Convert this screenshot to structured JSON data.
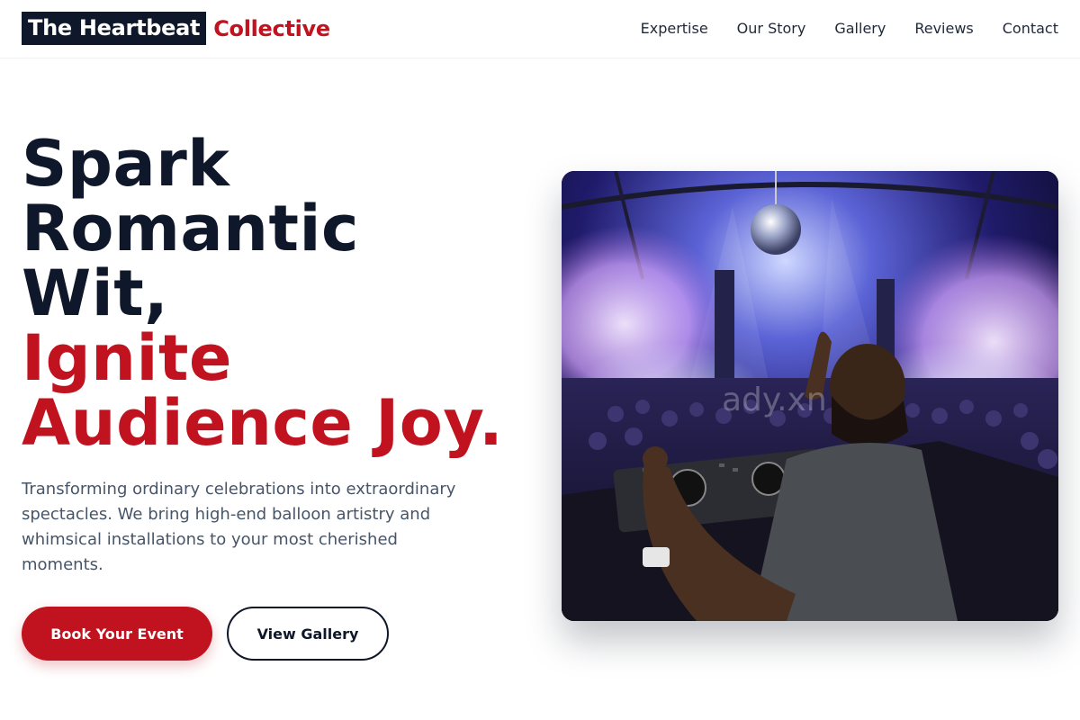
{
  "brand": {
    "name_part1": "The Heartbeat",
    "name_part2": "Collective",
    "accent_color": "#c1121f",
    "dark_color": "#0f172a"
  },
  "nav": {
    "items": [
      {
        "label": "Expertise"
      },
      {
        "label": "Our Story"
      },
      {
        "label": "Gallery"
      },
      {
        "label": "Reviews"
      },
      {
        "label": "Contact"
      }
    ]
  },
  "hero": {
    "headline_lines": [
      {
        "text": "Spark"
      },
      {
        "text": "Romantic"
      },
      {
        "text": "Wit,"
      },
      {
        "text": "Ignite"
      },
      {
        "text": "Audience Joy."
      }
    ],
    "subtext": "Transforming ordinary celebrations into extraordinary spectacles. We bring high-end balloon artistry and whimsical installations to your most cherished moments.",
    "primary_button": "Book Your Event",
    "secondary_button": "View Gallery",
    "image": {
      "description_icon": "dj-party-photo",
      "watermark": "ady.xn"
    }
  }
}
